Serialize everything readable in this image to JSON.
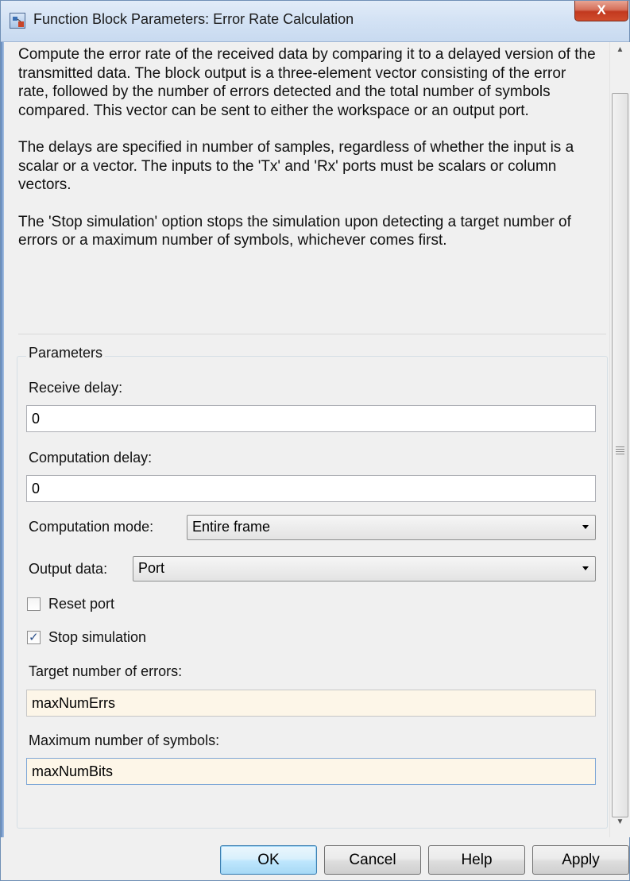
{
  "window": {
    "title": "Function Block Parameters: Error Rate Calculation",
    "close_label": "X"
  },
  "description": {
    "para1": "Compute the error rate of the received data by comparing it to a delayed version of the transmitted data. The block output is a three-element vector consisting of the error rate, followed by the number of errors detected and the total number of symbols compared. This vector can be sent to either the workspace or an output port.",
    "para2": "The delays are specified in number of samples, regardless of whether the input is a scalar or a vector. The inputs to the 'Tx' and 'Rx' ports must be scalars or column vectors.",
    "para3": "The 'Stop simulation' option stops the simulation upon detecting a target number of errors or a maximum number of symbols, whichever comes first."
  },
  "parameters": {
    "legend": "Parameters",
    "receive_delay": {
      "label": "Receive delay:",
      "value": "0"
    },
    "computation_delay": {
      "label": "Computation delay:",
      "value": "0"
    },
    "computation_mode": {
      "label": "Computation mode:",
      "value": "Entire frame"
    },
    "output_data": {
      "label": "Output data:",
      "value": "Port"
    },
    "reset_port": {
      "label": "Reset port",
      "checked": false
    },
    "stop_simulation": {
      "label": "Stop simulation",
      "checked": true
    },
    "target_errors": {
      "label": "Target number of errors:",
      "value": "maxNumErrs"
    },
    "max_symbols": {
      "label": "Maximum number of symbols:",
      "value": "maxNumBits"
    }
  },
  "buttons": {
    "ok": "OK",
    "cancel": "Cancel",
    "help": "Help",
    "apply": "Apply"
  },
  "scrollbar": {
    "up_glyph": "▲",
    "down_glyph": "▼"
  },
  "colors": {
    "variable_field_bg": "#fdf6e8",
    "close_button": "#c2391f"
  }
}
